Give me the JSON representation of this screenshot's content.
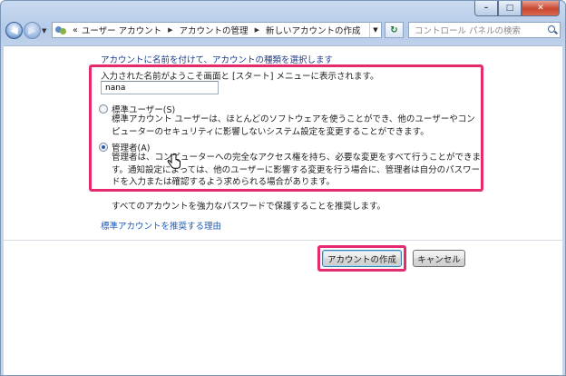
{
  "titlebar": {
    "minimize_glyph": "–",
    "maximize_glyph": "□",
    "close_glyph": "✕"
  },
  "nav": {
    "back_glyph": "◀",
    "forward_glyph": "▶",
    "breadcrumb_overflow": "«",
    "breadcrumbs": [
      "ユーザー アカウント",
      "アカウントの管理",
      "新しいアカウントの作成"
    ],
    "separator": "▶",
    "refresh_glyph": "↻",
    "search_placeholder": "コントロール パネルの検索"
  },
  "form": {
    "heading": "アカウントに名前を付けて、アカウントの種類を選択します",
    "intro": "入力された名前がようこそ画面と [スタート] メニューに表示されます。",
    "name_value": "nana",
    "options": [
      {
        "label": "標準ユーザー(S)",
        "checked": false,
        "description": "標準アカウント ユーザーは、ほとんどのソフトウェアを使うことができ、他のユーザーやコンピューターのセキュリティに影響しないシステム設定を変更することができます。"
      },
      {
        "label": "管理者(A)",
        "checked": true,
        "description": "管理者は、コンピューターへの完全なアクセス権を持ち、必要な変更をすべて行うことができます。通知設定によっては、他のユーザーに影響する変更を行う場合に、管理者は自分のパスワードを入力または確認するよう求められる場合があります。"
      }
    ],
    "recommendation": "すべてのアカウントを強力なパスワードで保護することを推奨します。",
    "link": "標準アカウントを推奨する理由"
  },
  "buttons": {
    "create": "アカウントの作成",
    "cancel": "キャンセル"
  },
  "colors": {
    "highlight": "#e52a6e",
    "link": "#1e5bb8",
    "heading": "#1e3a8a"
  }
}
